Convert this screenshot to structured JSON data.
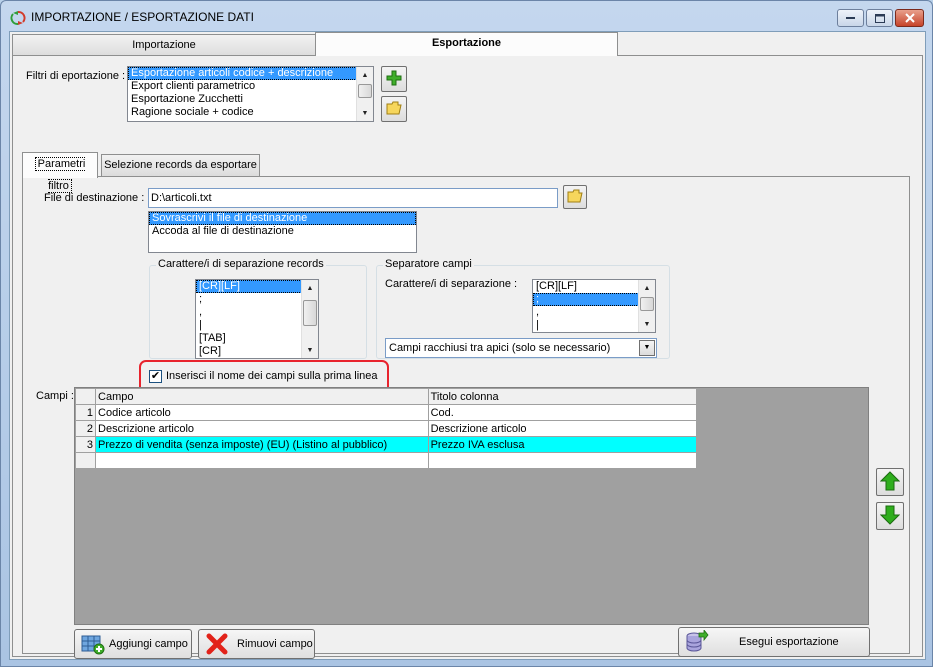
{
  "window": {
    "title": "IMPORTAZIONE / ESPORTAZIONE DATI"
  },
  "main_tabs": [
    {
      "label": "Importazione",
      "active": false
    },
    {
      "label": "Esportazione",
      "active": true
    }
  ],
  "filters": {
    "label": "Filtri di eportazione :",
    "items": [
      "Esportazione articoli codice + descrizione",
      "Export clienti parametrico",
      "Esportazione Zucchetti",
      "Ragione sociale + codice"
    ],
    "selected_index": 0
  },
  "sub_tabs": [
    {
      "label": "Parametri filtro",
      "active": true
    },
    {
      "label": "Selezione records da esportare",
      "active": false
    }
  ],
  "destination": {
    "label": "File di destinazione :",
    "value": "D:\\articoli.txt",
    "mode_options": [
      "Sovrascrivi il file di destinazione",
      "Accoda al file di destinazione"
    ],
    "mode_selected_index": 0
  },
  "record_separator": {
    "title": "Carattere/i di separazione records",
    "items": [
      "[CR][LF]",
      ";",
      ",",
      "|",
      "[TAB]",
      "[CR]"
    ],
    "selected_index": 0
  },
  "field_separator": {
    "title": "Separatore campi",
    "label": "Carattere/i di separazione :",
    "items": [
      "[CR][LF]",
      ";",
      ",",
      "|"
    ],
    "selected_index": 1,
    "quote_mode": "Campi racchiusi tra apici (solo se necessario)"
  },
  "header_checkbox": {
    "label": "Inserisci il nome dei campi sulla prima linea",
    "checked": true
  },
  "fields_grid": {
    "label": "Campi :",
    "columns": [
      "Campo",
      "Titolo colonna"
    ],
    "rows": [
      {
        "num": "1",
        "campo": "Codice articolo",
        "titolo": "Cod."
      },
      {
        "num": "2",
        "campo": "Descrizione articolo",
        "titolo": "Descrizione articolo"
      },
      {
        "num": "3",
        "campo": "Prezzo di vendita (senza imposte) (EU) (Listino al pubblico)",
        "titolo": "Prezzo IVA esclusa"
      }
    ],
    "selected_row": 2
  },
  "buttons": {
    "add_field": "Aggiungi campo",
    "remove_field": "Rimuovi campo",
    "run_export": "Esegui esportazione"
  },
  "icons": {
    "app": "app-icon",
    "add_filter": "plus-icon",
    "open_filter": "folder-icon",
    "browse_file": "folder-icon",
    "move_up": "arrow-up-icon",
    "move_down": "arrow-down-icon",
    "add_field": "add-table-icon",
    "remove_field": "x-icon",
    "run_export": "database-export-icon"
  },
  "colors": {
    "selection": "#3399ff",
    "grid_selected_row": "#00ffff",
    "highlight_ring": "#e8232d",
    "plus_icon": "#3fae2a",
    "arrow_icon": "#2fae1d"
  }
}
